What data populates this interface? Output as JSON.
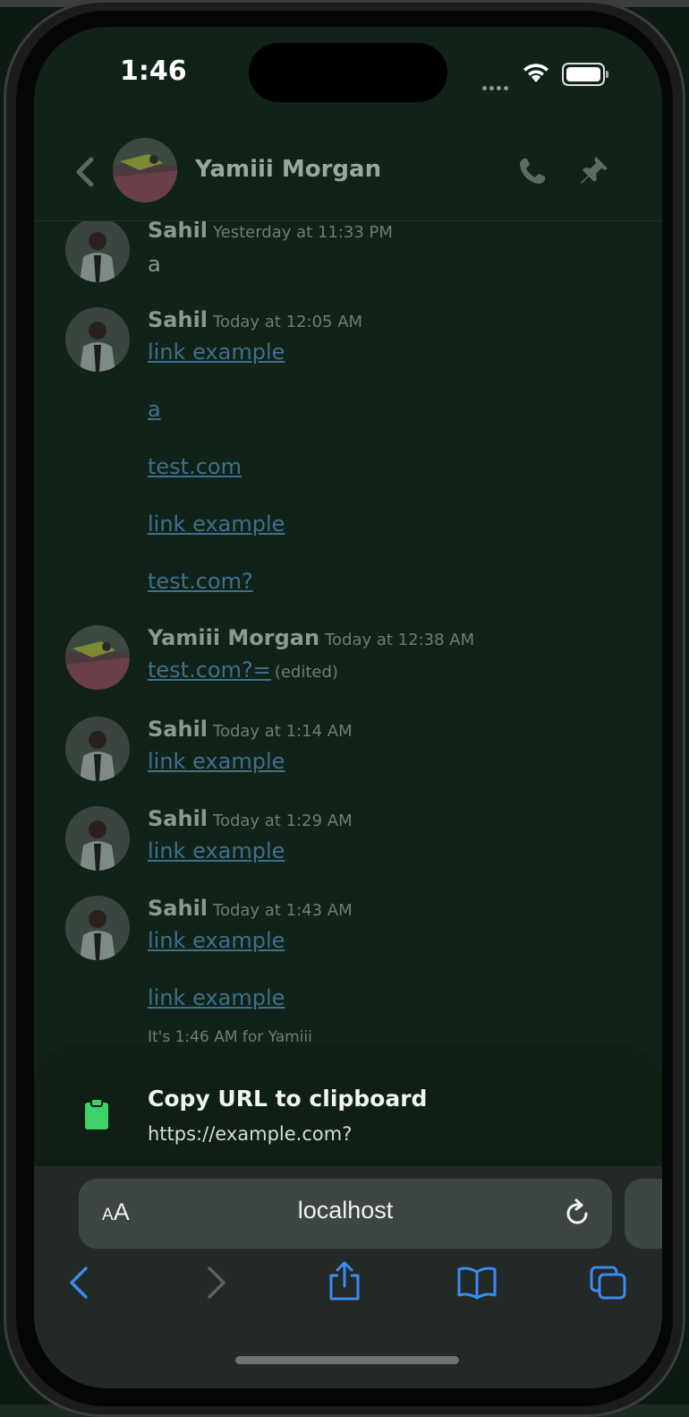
{
  "status_bar": {
    "time": "1:46"
  },
  "chat_header": {
    "contact_name": "Yamiii Morgan",
    "back_icon": "chevron-left-icon",
    "call_icon": "phone-icon",
    "pin_icon": "pin-icon"
  },
  "messages": [
    {
      "author": "Sahil",
      "timestamp": "Yesterday at 11:33 PM",
      "lines": [
        "a"
      ],
      "avatar": "sahil-avatar"
    },
    {
      "author": "Sahil",
      "timestamp": "Today at 12:05 AM",
      "lines": [
        "link example",
        "a",
        "test.com",
        "link example",
        "test.com?"
      ],
      "avatar": "sahil-avatar"
    },
    {
      "author": "Yamiii Morgan",
      "timestamp": "Today at 12:38 AM",
      "lines": [
        "test.com?="
      ],
      "edited": "(edited)",
      "avatar": "yamiii-avatar"
    },
    {
      "author": "Sahil",
      "timestamp": "Today at 1:14 AM",
      "lines": [
        "link example"
      ],
      "avatar": "sahil-avatar"
    },
    {
      "author": "Sahil",
      "timestamp": "Today at 1:29 AM",
      "lines": [
        "link example"
      ],
      "avatar": "sahil-avatar"
    },
    {
      "author": "Sahil",
      "timestamp": "Today at 1:43 AM",
      "lines": [
        "link example",
        "link example"
      ],
      "avatar": "sahil-avatar"
    }
  ],
  "local_time_note": "It's 1:46 AM for Yamiii",
  "clipboard_sheet": {
    "title": "Copy URL to clipboard",
    "url": "https://example.com?",
    "icon": "clipboard-icon"
  },
  "browser": {
    "aa_small": "A",
    "aa_big": "A",
    "address": "localhost",
    "reload_icon": "reload-icon"
  },
  "toolbar": [
    "back-icon",
    "forward-icon",
    "share-icon",
    "bookmarks-icon",
    "tabs-icon"
  ],
  "colors": {
    "link": "#3f6f8c",
    "background": "#112219",
    "clipboard_green": "#3ed06a",
    "toolbar_blue": "#3d8bf0"
  }
}
